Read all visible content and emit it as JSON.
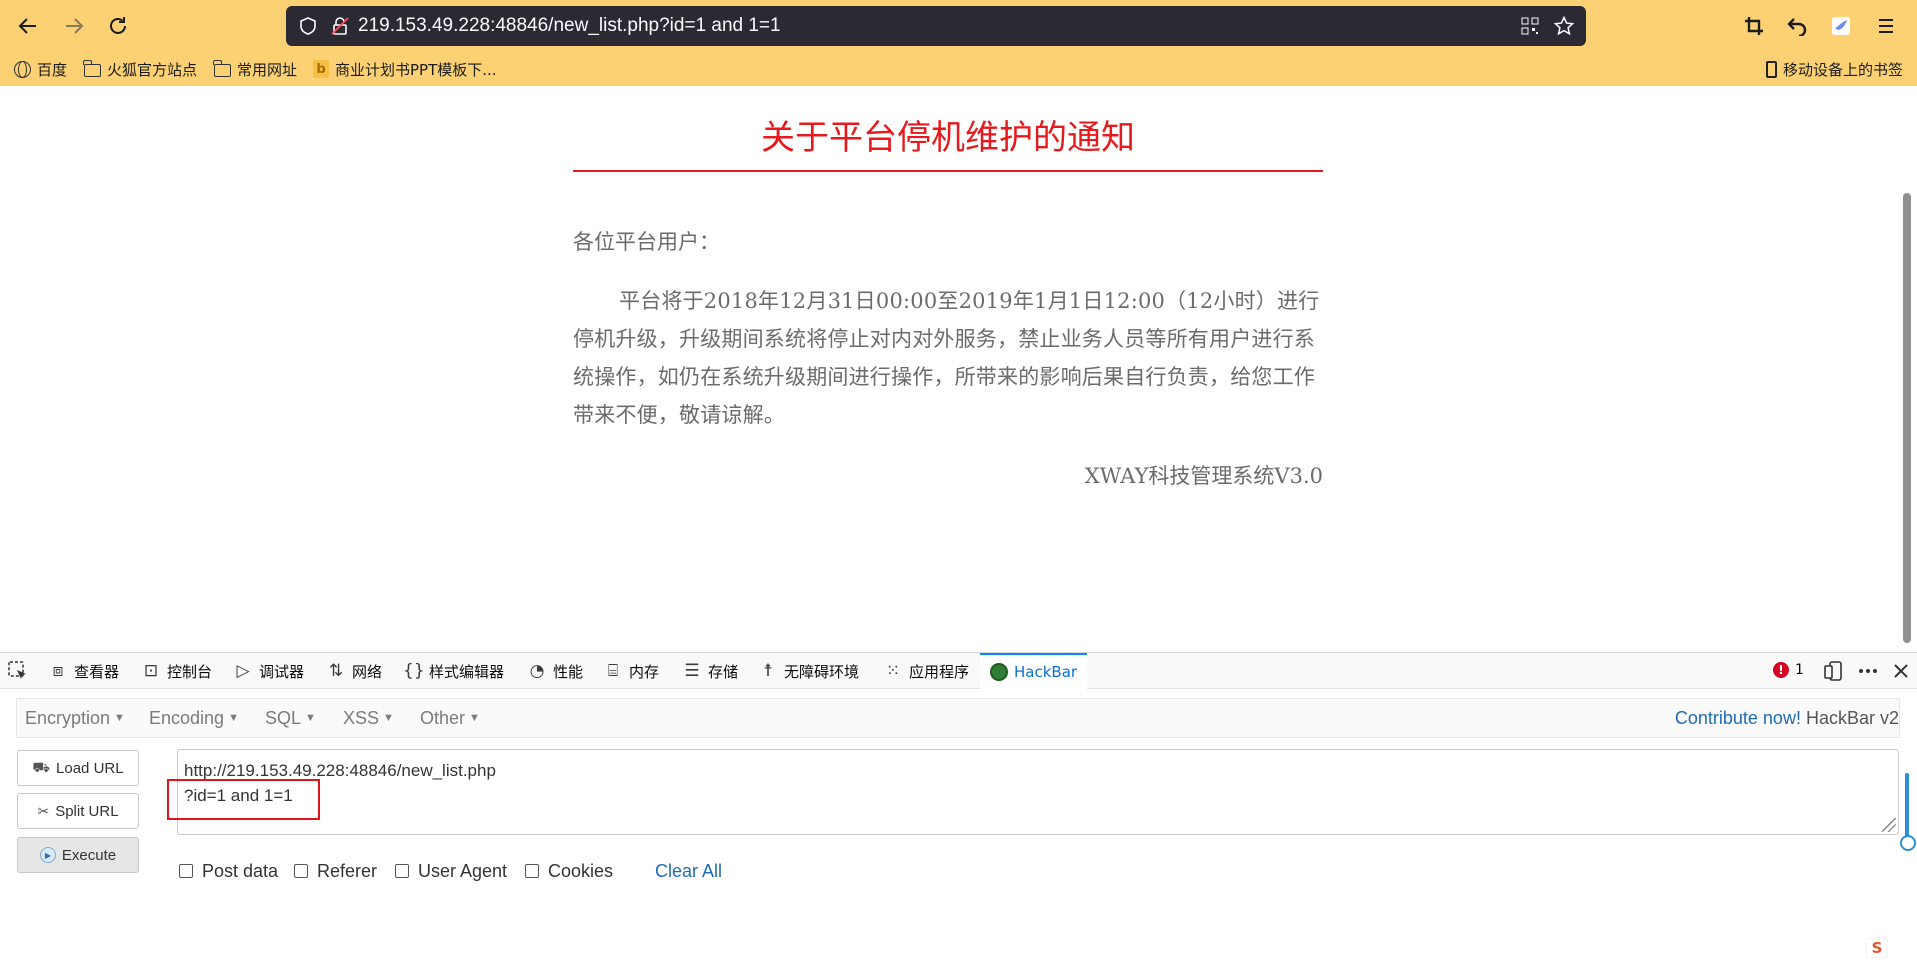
{
  "browser": {
    "url": "219.153.49.228:48846/new_list.php?id=1 and 1=1",
    "bookmarks": [
      {
        "label": "百度",
        "icon": "globe-icon"
      },
      {
        "label": "火狐官方站点",
        "icon": "folder-icon"
      },
      {
        "label": "常用网址",
        "icon": "folder-icon"
      },
      {
        "label": "商业计划书PPT模板下...",
        "icon": "bing-icon"
      }
    ],
    "mobile_bookmarks": "移动设备上的书签"
  },
  "notice": {
    "title": "关于平台停机维护的通知",
    "greeting": "各位平台用户：",
    "body": "平台将于2018年12月31日00:00至2019年1月1日12:00（12小时）进行停机升级，升级期间系统将停止对内对外服务，禁止业务人员等所有用户进行系统操作，如仍在系统升级期间进行操作，所带来的影响后果自行负责，给您工作带来不便，敬请谅解。",
    "system_name": "XWAY科技管理系统V3.0"
  },
  "devtools": {
    "tabs": [
      {
        "label": "查看器",
        "icon": "inspector-icon"
      },
      {
        "label": "控制台",
        "icon": "console-icon"
      },
      {
        "label": "调试器",
        "icon": "debugger-icon"
      },
      {
        "label": "网络",
        "icon": "network-icon"
      },
      {
        "label": "样式编辑器",
        "icon": "style-editor-icon"
      },
      {
        "label": "性能",
        "icon": "performance-icon"
      },
      {
        "label": "内存",
        "icon": "memory-icon"
      },
      {
        "label": "存储",
        "icon": "storage-icon"
      },
      {
        "label": "无障碍环境",
        "icon": "accessibility-icon"
      },
      {
        "label": "应用程序",
        "icon": "application-icon"
      },
      {
        "label": "HackBar",
        "icon": "hackbar-icon"
      }
    ],
    "error_count": "1"
  },
  "hackbar": {
    "menus": [
      "Encryption",
      "Encoding",
      "SQL",
      "XSS",
      "Other"
    ],
    "contribute_link": "Contribute now!",
    "version": "HackBar v2",
    "buttons": {
      "load": "Load URL",
      "split": "Split URL",
      "execute": "Execute"
    },
    "url_line1": "http://219.153.49.228:48846/new_list.php",
    "url_line2": "?id=1 and 1=1",
    "options": [
      "Post data",
      "Referer",
      "User Agent",
      "Cookies"
    ],
    "clear_all": "Clear All"
  },
  "colors": {
    "toolbar": "#fcd174",
    "title_red": "#e8191c",
    "highlight_box": "#e0141c",
    "link_blue": "#1e6bb8"
  }
}
